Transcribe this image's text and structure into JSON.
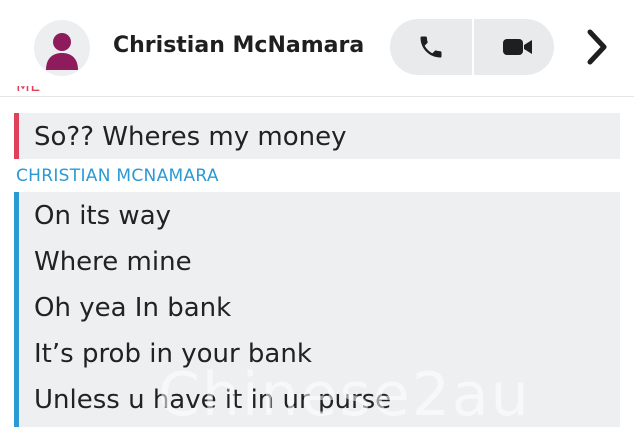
{
  "header": {
    "contact_name": "Christian McNamara",
    "avatar_icon": "person-silhouette-icon",
    "avatar_color": "#8e1b5c",
    "call_icon": "phone-icon",
    "video_icon": "video-camera-icon",
    "more_icon": "chevron-right-icon"
  },
  "chat": {
    "me": {
      "sender_label": "ME",
      "accent_color": "#e0405c",
      "messages": [
        "So?? Wheres my money"
      ]
    },
    "them": {
      "sender_label": "CHRISTIAN MCNAMARA",
      "accent_color": "#2b9ad3",
      "messages": [
        "On its way",
        "Where mine",
        "Oh yea In bank",
        "It’s prob in your bank",
        "Unless u have it in ur purse"
      ]
    }
  },
  "watermark": {
    "text": "Chinese2au"
  }
}
